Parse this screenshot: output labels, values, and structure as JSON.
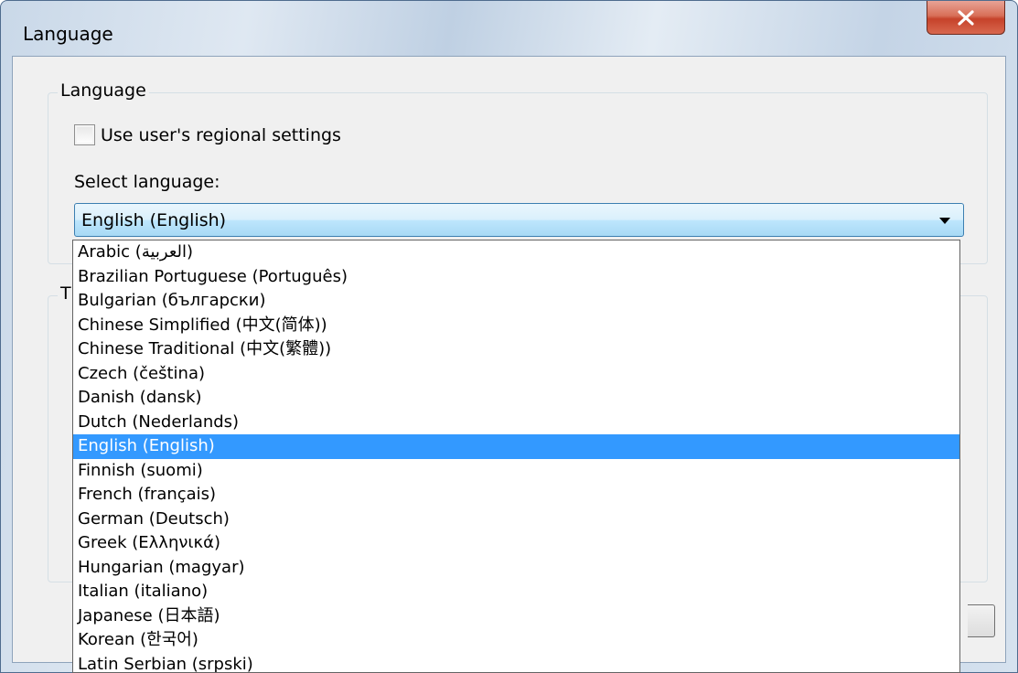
{
  "window": {
    "title": "Language",
    "close_label": "close-icon"
  },
  "language_group": {
    "legend": "Language",
    "use_regional_settings": {
      "label": "Use user's regional settings",
      "checked": false
    },
    "select_label": "Select language:",
    "selected_language": "English (English)"
  },
  "second_group": {
    "legend_partial": "T"
  },
  "dropdown": {
    "items": [
      "Arabic (العربية)",
      "Brazilian Portuguese (Português)",
      "Bulgarian (български)",
      "Chinese Simplified (中文(简体))",
      "Chinese Traditional (中文(繁體))",
      "Czech (čeština)",
      "Danish (dansk)",
      "Dutch (Nederlands)",
      "English (English)",
      "Finnish (suomi)",
      "French (français)",
      "German (Deutsch)",
      "Greek (Ελληνικά)",
      "Hungarian (magyar)",
      "Italian (italiano)",
      "Japanese (日本語)",
      "Korean (한국어)",
      "Latin Serbian (srpski)"
    ],
    "selected_index": 8
  },
  "colors": {
    "selection": "#3399ff",
    "combo_border": "#3c7fb1",
    "dialog_bg": "#f0f0f0",
    "close_button": "#c6422a"
  }
}
